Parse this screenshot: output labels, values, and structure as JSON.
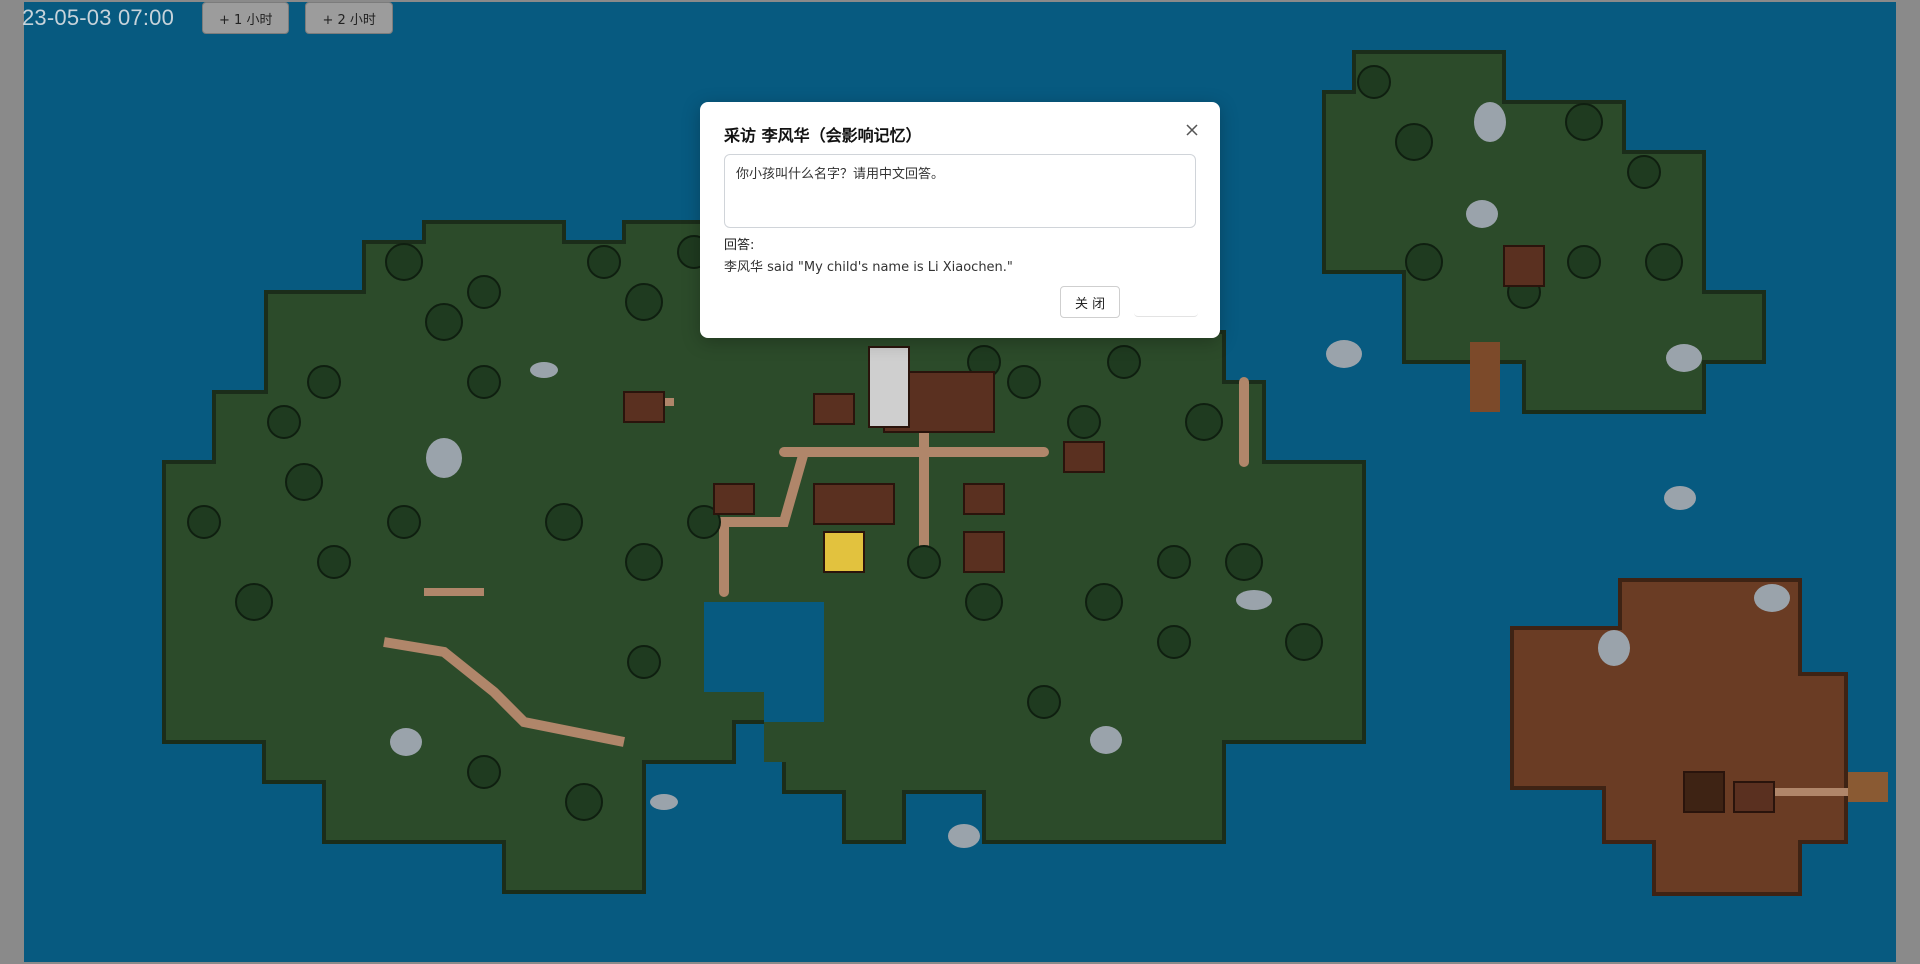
{
  "header": {
    "clock": "23-05-03 07:00",
    "buttons": [
      "+ 1 小时",
      "+ 2 小时"
    ]
  },
  "dialog": {
    "title": "采访 李风华（会影响记忆）",
    "question_value": "你小孩叫什么名字？请用中文回答。",
    "answer_label": "回答:",
    "answer_text": "李风华 said \"My child's name is Li Xiaochen.\"",
    "close_label": "关 闭"
  },
  "colors": {
    "sea": "#075a80",
    "grass": "#2b4a2a",
    "dirt": "#6a3c24",
    "tree": "#1d3a1d"
  }
}
